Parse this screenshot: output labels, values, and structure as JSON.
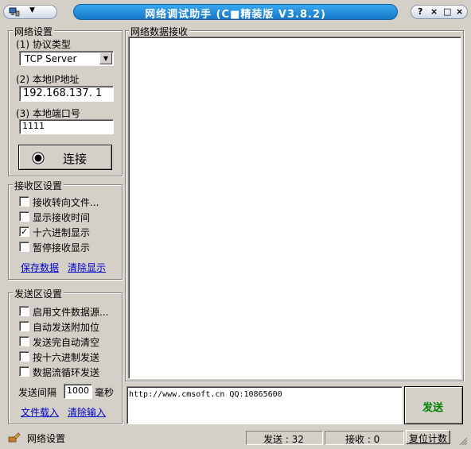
{
  "window": {
    "title": "网络调试助手 (C■精装版 V3.8.2)",
    "system_menu_icon": "network-app-icon",
    "buttons": {
      "help": "?",
      "minimize": "×",
      "maximize": "□",
      "close": "×"
    }
  },
  "network_settings": {
    "title": "网络设置",
    "protocol_label": "(1) 协议类型",
    "protocol_value": "TCP Server",
    "ip_label": "(2) 本地IP地址",
    "ip_value": "192.168.137. 1",
    "port_label": "(3) 本地端口号",
    "port_value": "1111",
    "connect_label": "连接"
  },
  "receive_settings": {
    "title": "接收区设置",
    "options": [
      {
        "label": "接收转向文件...",
        "checked": false
      },
      {
        "label": "显示接收时间",
        "checked": false
      },
      {
        "label": "十六进制显示",
        "checked": true
      },
      {
        "label": "暂停接收显示",
        "checked": false
      }
    ],
    "save_link": "保存数据",
    "clear_link": "清除显示"
  },
  "send_settings": {
    "title": "发送区设置",
    "options": [
      {
        "label": "启用文件数据源...",
        "checked": false
      },
      {
        "label": "自动发送附加位",
        "checked": false
      },
      {
        "label": "发送完自动清空",
        "checked": false
      },
      {
        "label": "按十六进制发送",
        "checked": false
      },
      {
        "label": "数据流循环发送",
        "checked": false
      }
    ],
    "interval_label": "发送间隔",
    "interval_value": "1000",
    "interval_unit": "毫秒",
    "load_file_link": "文件载入",
    "clear_input_link": "清除输入"
  },
  "receive_area": {
    "title": "网络数据接收"
  },
  "send_area": {
    "text": "http://www.cmsoft.cn QQ:10865600",
    "send_label": "发送"
  },
  "status": {
    "text": "网络设置",
    "send_count": "发送 : 32",
    "recv_count": "接收 : 0",
    "reset_label": "复位计数"
  },
  "colors": {
    "title_bar": "#1e88d8",
    "send_button_text": "#008000",
    "link": "#0000cc"
  }
}
